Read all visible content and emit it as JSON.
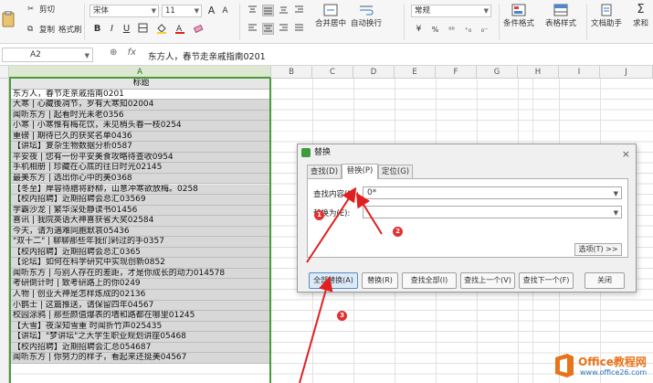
{
  "ribbon": {
    "cut": "剪切",
    "copy": "复制",
    "format_painter": "格式刷",
    "font_name": "宋体",
    "font_size": "11",
    "number_format": "常规",
    "merge_center": "合并居中",
    "auto_wrap": "自动换行",
    "conditional_format": "条件格式",
    "table_style": "表格样式",
    "doc_assistant": "文档助手",
    "sum": "求和",
    "bold": "B",
    "italic": "I",
    "underline": "U",
    "increase_font": "A",
    "decrease_font": "A"
  },
  "formula_bar": {
    "cell_ref": "A2",
    "fx": "fx",
    "content": "东方人，春节走亲戚指南0201"
  },
  "columns": [
    "A",
    "B",
    "C",
    "D",
    "E",
    "F",
    "G",
    "H",
    "I",
    "J"
  ],
  "sheet": {
    "header": "标题",
    "rows": [
      "东方人，春节走亲戚指南0201",
      "大寒 | 心藏後凋节，岁有大寒知02004",
      "闻听东方 | 起看时光未老0356",
      "小寒 | 小寒惟有梅花饮，未见梢头春一枝0254",
      "重磅 | 期待已久的获奖名单0436",
      "【讲坛】复杂生物数据分析0587",
      "平安夜 | 您有一份平安美食攻略待查收0954",
      "手机相册 | 珍藏在心底的往日时光02145",
      "最美东方 | 选出你心中的美0368",
      "【冬至】岸容待腊将舒柳，山意冲寒欲放梅。0258",
      "【校内招聘】近期招聘会总汇03569",
      "学霸沙龙 | 繁华深处静读书01456",
      "喜讯 | 我院英语大神喜获省大奖02584",
      "今天，请为遇难同胞默哀05436",
      "\"双十二\" | 聊聊那些年我们剁过的手0357",
      "【校内招聘】近期招聘会总汇0365",
      "【论坛】如何在科学研究中实现创新0852",
      "闻听东方 | 与别人存在的差距，才是你成长的动力014578",
      "考研倒计时 | 致考研路上的你0249",
      "人物 | 创业大神是怎样炼成的02136",
      "小鹊士 | 这篇推送，请保留四年04567",
      "校园涂鸦 | 那些颜值爆表的墙和路都在哪里01245",
      "【大雪】夜深知雪重 时闻折竹声025435",
      "【讲坛】\"梦讲坛\"之大学生职业规划讲座05468",
      "【校内招聘】近期招聘会汇总054687",
      "闻听东方 | 你努力的样子，看起来还挺美04567"
    ]
  },
  "dialog": {
    "title": "替换",
    "tabs": [
      "查找(D)",
      "替换(P)",
      "定位(G)"
    ],
    "find_label": "查找内容(N):",
    "find_value": "0*",
    "replace_label": "替换为(E):",
    "replace_value": "",
    "options_button": "选项(T) >>",
    "buttons": [
      "全部替换(A)",
      "替换(R)",
      "查找全部(I)",
      "查找上一个(V)",
      "查找下一个(F)",
      "关闭"
    ]
  },
  "annotations": [
    "1",
    "2",
    "3"
  ],
  "watermark": {
    "brand": "Office教程网",
    "url": "www.office26.com"
  }
}
